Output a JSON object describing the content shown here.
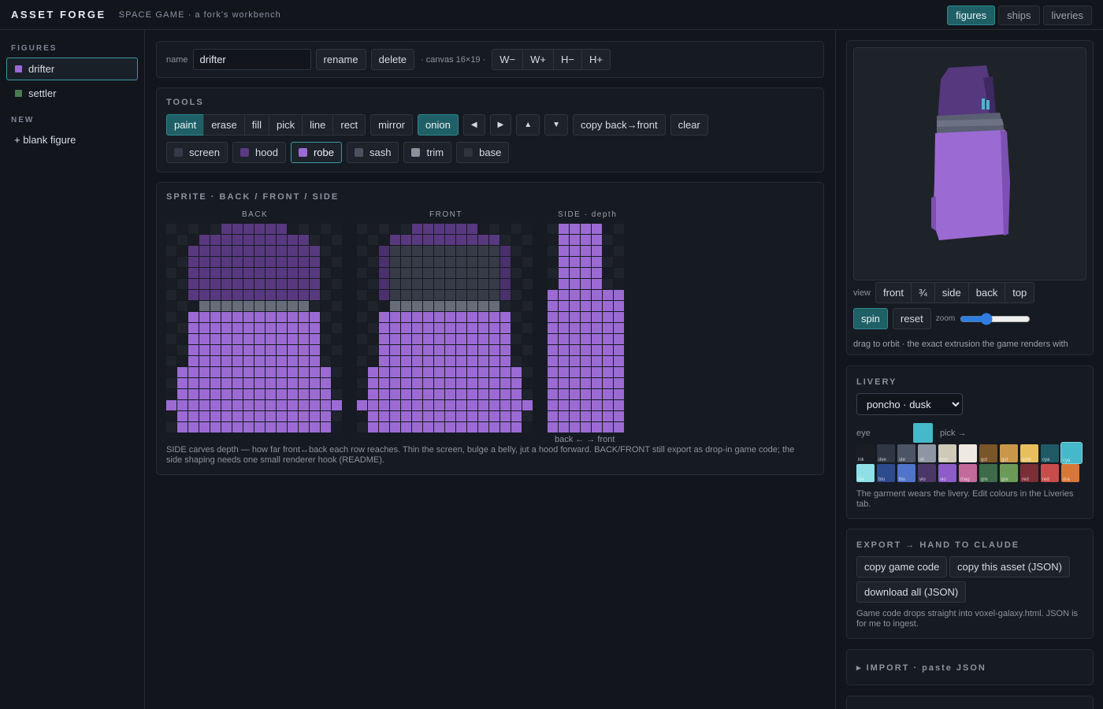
{
  "header": {
    "brand": "ASSET FORGE",
    "project": "SPACE GAME",
    "tagline": "· a fork's workbench",
    "tabs": [
      {
        "label": "figures",
        "active": true
      },
      {
        "label": "ships",
        "active": false
      },
      {
        "label": "liveries",
        "active": false
      }
    ]
  },
  "sidebar": {
    "figures_label": "FIGURES",
    "figures": [
      {
        "name": "drifter",
        "color": "#9b6bd3",
        "active": true
      },
      {
        "name": "settler",
        "color": "#4a7a52",
        "active": false
      }
    ],
    "new_label": "NEW",
    "blank_figure": "+ blank figure"
  },
  "namebar": {
    "name_label": "name",
    "name_value": "drifter",
    "rename": "rename",
    "delete": "delete",
    "canvas_info": "· canvas 16×19 ·",
    "size_buttons": [
      "W−",
      "W+",
      "H−",
      "H+"
    ]
  },
  "tools": {
    "title": "TOOLS",
    "modes": [
      "paint",
      "erase",
      "fill",
      "pick",
      "line",
      "rect"
    ],
    "mirror": "mirror",
    "onion": "onion",
    "arrows": [
      "◀",
      "▶",
      "▲",
      "▼"
    ],
    "copy_back_front": "copy back→front",
    "clear": "clear",
    "layers": [
      {
        "name": "screen",
        "color": "#343a46"
      },
      {
        "name": "hood",
        "color": "#5a3a82"
      },
      {
        "name": "robe",
        "color": "#9b6bd3"
      },
      {
        "name": "sash",
        "color": "#4c525d"
      },
      {
        "name": "trim",
        "color": "#8a919c"
      },
      {
        "name": "base",
        "color": "#2f343d"
      }
    ]
  },
  "sprite": {
    "title": "SPRITE · BACK / FRONT / SIDE",
    "back_label": "BACK",
    "front_label": "FRONT",
    "side_label": "SIDE · depth",
    "side_caption": "back ← → front",
    "note": "SIDE carves depth — how far front↔back each row reaches. Thin the screen, bulge a belly, jut a hood forward. BACK/FRONT still export as drop-in game code; the side shaping needs one small renderer hook (README)."
  },
  "preview": {
    "view_label": "view",
    "views": [
      "front",
      "¾",
      "side",
      "back",
      "top"
    ],
    "spin": "spin",
    "reset": "reset",
    "zoom_label": "zoom",
    "zoom_value": 35,
    "hint": "drag to orbit · the exact extrusion the game renders with"
  },
  "livery": {
    "title": "LIVERY",
    "selected": "poncho · dusk",
    "eye_label": "eye",
    "eye_color": "#45b9c9",
    "pick_label": "pick →",
    "palette_row1": [
      {
        "label": "ink",
        "color": "#1a1d24"
      },
      {
        "label": "dee",
        "color": "#2f3644"
      },
      {
        "label": "ste",
        "color": "#4c5566"
      },
      {
        "label": "sil",
        "color": "#8f96a3"
      },
      {
        "label": "bon",
        "color": "#cfc9b8"
      },
      {
        "label": "",
        "color": "#eeeae2"
      },
      {
        "label": "gol",
        "color": "#7a5528"
      },
      {
        "label": "gol",
        "color": "#c9974a"
      },
      {
        "label": "amb",
        "color": "#e9bf5e"
      },
      {
        "label": "cya",
        "color": "#1f5a66"
      },
      {
        "label": "cya",
        "color": "#45b9c9",
        "selected": true
      }
    ],
    "palette_row2": [
      {
        "label": "ice",
        "color": "#8fe0e6"
      },
      {
        "label": "blu",
        "color": "#2d4a8a"
      },
      {
        "label": "blu",
        "color": "#4f74c9"
      },
      {
        "label": "vio",
        "color": "#4a3768"
      },
      {
        "label": "vio",
        "color": "#8d5cc6"
      },
      {
        "label": "mag",
        "color": "#c26a9a"
      },
      {
        "label": "gre",
        "color": "#3d6a48"
      },
      {
        "label": "gre",
        "color": "#6c9a58"
      },
      {
        "label": "red",
        "color": "#7a2f36"
      },
      {
        "label": "red",
        "color": "#c94c4c"
      },
      {
        "label": "ora",
        "color": "#d9773a"
      }
    ],
    "note": "The garment wears the livery. Edit colours in the Liveries tab."
  },
  "export": {
    "title": "EXPORT → HAND TO CLAUDE",
    "copy_game_code": "copy game code",
    "copy_asset": "copy this asset (JSON)",
    "download_all": "download all (JSON)",
    "note": "Game code drops straight into voxel-galaxy.html. JSON is for me to ingest."
  },
  "import": {
    "title": "▸ IMPORT · paste JSON"
  }
}
